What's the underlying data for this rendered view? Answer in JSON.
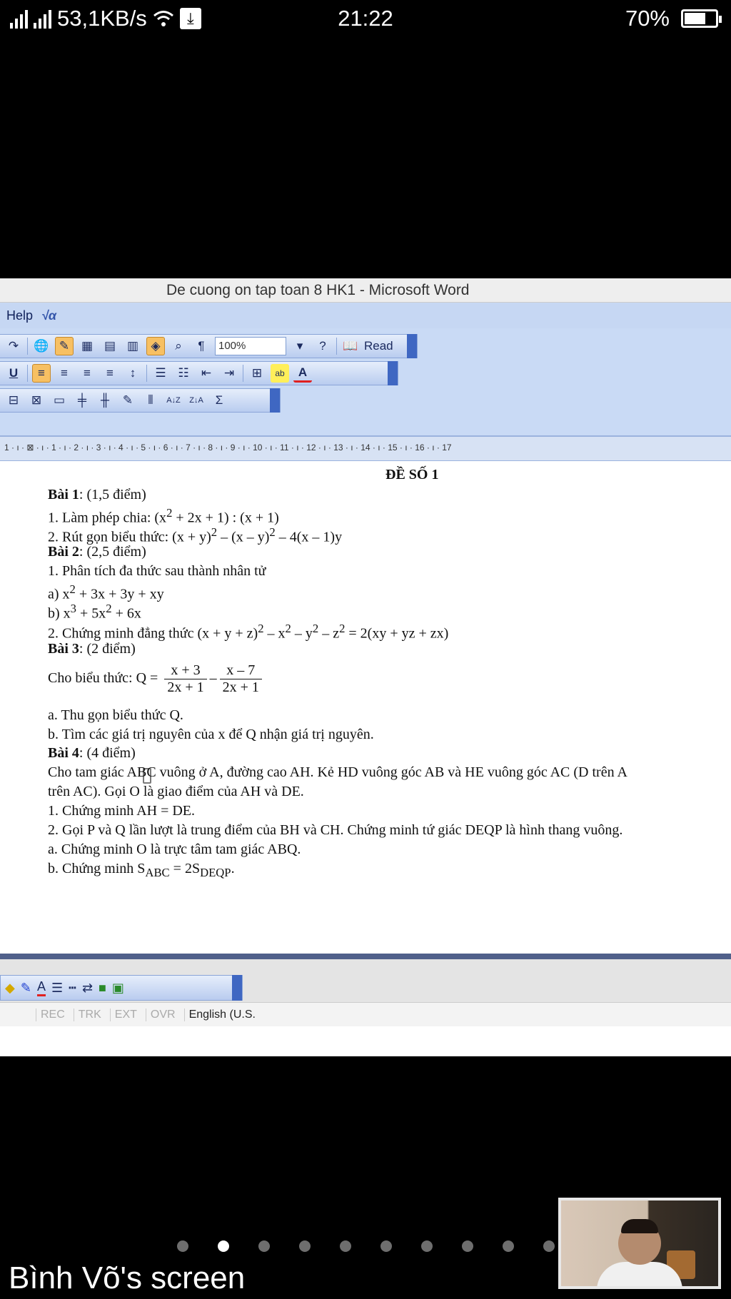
{
  "status_bar": {
    "network_speed": "53,1KB/s",
    "time": "21:22",
    "battery": "70%",
    "battery_level": 0.7,
    "download_icon": "download-icon"
  },
  "word": {
    "title": "De cuong on tap toan 8 HK1 - Microsoft Word",
    "menu": {
      "help": "Help",
      "equation": "√α"
    },
    "toolbar": {
      "zoom": "100%",
      "read": "Read",
      "pilcrow": "¶"
    },
    "formatting": {
      "underline": "U",
      "highlight": "ab",
      "font_color": "A"
    },
    "table_bar": {
      "sigma": "Σ",
      "sort_az": "A↓Z",
      "sort_za": "Z↓A"
    },
    "ruler": "1 · ı · ⊠ · ı · 1 · ı · 2 · ı · 3 · ı · 4 · ı · 5 · ı · 6 · ı · 7 · ı · 8 · ı · 9 · ı · 10 · ı · 11 · ı · 12 · ı · 13 · ı · 14 · ı · 15 · ı · 16 · ı · 17",
    "status": {
      "rec": "REC",
      "trk": "TRK",
      "ext": "EXT",
      "ovr": "OVR",
      "language": "English (U.S."
    }
  },
  "document": {
    "heading": "ĐỀ SỐ 1",
    "b1_label": "Bài 1",
    "b1_points": ": (1,5 điểm)",
    "b1_q1_text": "1. Làm phép chia: (x",
    "b1_q1_rest": " + 2x + 1) : (x + 1)",
    "b1_q2_a": "2. Rút gọn biểu thức: (x + y)",
    "b1_q2_b": " – (x – y)",
    "b1_q2_c": " – 4(x – 1)y",
    "b2_label": "Bài 2",
    "b2_points": ": (2,5 điểm)",
    "b2_q1": "1. Phân tích đa thức sau thành nhân tử",
    "b2_a_pre": "a) x",
    "b2_a_post": " + 3x + 3y + xy",
    "b2_b_pre": "b) x",
    "b2_b_mid": " + 5x",
    "b2_b_post": " + 6x",
    "b2_q2_a": "2. Chứng minh đẳng thức (x + y + z)",
    "b2_q2_b": " – x",
    "b2_q2_c": " – y",
    "b2_q2_d": " – z",
    "b2_q2_e": " = 2(xy + yz + zx)",
    "sup2": "2",
    "sup3": "3",
    "b3_label": "Bài 3",
    "b3_points": ": (2 điểm)",
    "b3_expr_pre": "Cho biểu thức: Q =",
    "frac1_num": "x + 3",
    "frac1_den": "2x + 1",
    "minus": "–",
    "frac2_num": "x – 7",
    "frac2_den": "2x + 1",
    "b3_a": "a. Thu gọn biểu thức Q.",
    "b3_b": "b. Tìm các giá trị nguyên của x để Q nhận giá trị nguyên.",
    "b4_label": "Bài 4",
    "b4_points": ": (4 điểm)",
    "b4_line1": "Cho tam giác ABC vuông ở A, đường cao AH. Kẻ HD vuông góc AB và HE vuông góc AC (D trên A",
    "b4_line2": "trên AC). Gọi O là giao điểm của AH và DE.",
    "b4_q1": "1. Chứng minh AH = DE.",
    "b4_q2": "2. Gọi P và Q lần lượt là trung điểm của BH và CH. Chứng minh tứ giác DEQP là hình thang vuông.",
    "b4_q2a": "a. Chứng minh O là trực tâm tam giác ABQ.",
    "b4_q2b_pre": "b. Chứng minh S",
    "b4_q2b_sub1": "ABC",
    "b4_q2b_mid": " = 2S",
    "b4_q2b_sub2": "DEQP",
    "b4_q2b_end": "."
  },
  "share": {
    "screen_label": "Bình Võ's screen",
    "page_dots": 10,
    "active_dot": 1
  },
  "colors": {
    "toolbar_bg": "#c9daf5",
    "toolbar_active": "#f7c063",
    "toolbar_end": "#3f67c2"
  }
}
